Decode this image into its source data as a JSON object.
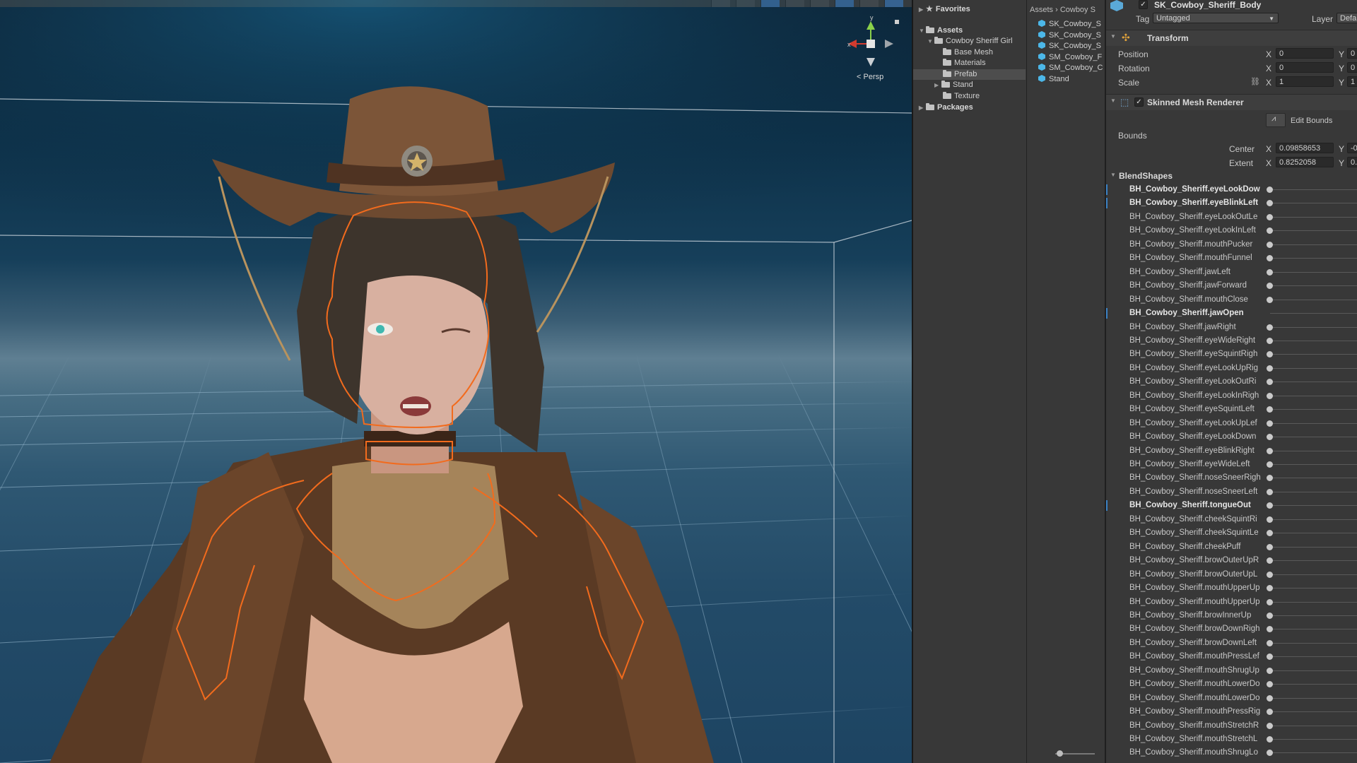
{
  "scene": {
    "projection_label": "Persp",
    "gizmo_axes": {
      "x": "x",
      "y": "y"
    },
    "toolbar_icons": [
      "effects-icon",
      "layers-icon",
      "lighting-icon",
      "audio-icon",
      "fx-icon",
      "search-scene-icon",
      "gizmos-icon",
      "camera-icon"
    ]
  },
  "project": {
    "favorites_label": "Favorites",
    "assets_label": "Assets",
    "tree": [
      {
        "label": "Cowboy Sheriff Girl",
        "level": 1
      },
      {
        "label": "Base Mesh",
        "level": 2
      },
      {
        "label": "Materials",
        "level": 2
      },
      {
        "label": "Prefab",
        "level": 2,
        "selected": true
      },
      {
        "label": "Stand",
        "level": 2,
        "expandable": true
      },
      {
        "label": "Texture",
        "level": 2
      }
    ],
    "packages_label": "Packages",
    "breadcrumb": [
      "Assets",
      "Cowboy S"
    ],
    "files": [
      "SK_Cowboy_S",
      "SK_Cowboy_S",
      "SK_Cowboy_S",
      "SM_Cowboy_F",
      "SM_Cowboy_C",
      "Stand"
    ]
  },
  "inspector": {
    "object_name": "SK_Cowboy_Sheriff_Body",
    "tag_label": "Tag",
    "tag_value": "Untagged",
    "layer_label": "Layer",
    "layer_value": "Defa",
    "transform": {
      "title": "Transform",
      "rows": [
        {
          "label": "Position",
          "x": "0",
          "y": "0"
        },
        {
          "label": "Rotation",
          "x": "0",
          "y": "0"
        },
        {
          "label": "Scale",
          "x": "1",
          "y": "1"
        }
      ]
    },
    "smr": {
      "title": "Skinned Mesh Renderer",
      "edit_bounds": "Edit Bounds",
      "bounds_label": "Bounds",
      "center_label": "Center",
      "center_x": "0.09858653",
      "center_y": "-0",
      "extent_label": "Extent",
      "extent_x": "0.8252058",
      "extent_y": "0."
    },
    "blendshapes_label": "BlendShapes",
    "blendshapes": [
      {
        "name": "BH_Cowboy_Sheriff.eyeLookDow",
        "bold": true,
        "changed": true
      },
      {
        "name": "BH_Cowboy_Sheriff.eyeBlinkLeft",
        "bold": true,
        "changed": true
      },
      {
        "name": "BH_Cowboy_Sheriff.eyeLookOutLe"
      },
      {
        "name": "BH_Cowboy_Sheriff.eyeLookInLeft"
      },
      {
        "name": "BH_Cowboy_Sheriff.mouthPucker"
      },
      {
        "name": "BH_Cowboy_Sheriff.mouthFunnel"
      },
      {
        "name": "BH_Cowboy_Sheriff.jawLeft"
      },
      {
        "name": "BH_Cowboy_Sheriff.jawForward"
      },
      {
        "name": "BH_Cowboy_Sheriff.mouthClose"
      },
      {
        "name": "BH_Cowboy_Sheriff.jawOpen",
        "bold": true,
        "changed": true,
        "no_knob": true
      },
      {
        "name": "BH_Cowboy_Sheriff.jawRight"
      },
      {
        "name": "BH_Cowboy_Sheriff.eyeWideRight"
      },
      {
        "name": "BH_Cowboy_Sheriff.eyeSquintRigh"
      },
      {
        "name": "BH_Cowboy_Sheriff.eyeLookUpRig"
      },
      {
        "name": "BH_Cowboy_Sheriff.eyeLookOutRi"
      },
      {
        "name": "BH_Cowboy_Sheriff.eyeLookInRigh"
      },
      {
        "name": "BH_Cowboy_Sheriff.eyeSquintLeft"
      },
      {
        "name": "BH_Cowboy_Sheriff.eyeLookUpLef"
      },
      {
        "name": "BH_Cowboy_Sheriff.eyeLookDown"
      },
      {
        "name": "BH_Cowboy_Sheriff.eyeBlinkRight"
      },
      {
        "name": "BH_Cowboy_Sheriff.eyeWideLeft"
      },
      {
        "name": "BH_Cowboy_Sheriff.noseSneerRigh"
      },
      {
        "name": "BH_Cowboy_Sheriff.noseSneerLeft"
      },
      {
        "name": "BH_Cowboy_Sheriff.tongueOut",
        "bold": true,
        "changed": true
      },
      {
        "name": "BH_Cowboy_Sheriff.cheekSquintRi"
      },
      {
        "name": "BH_Cowboy_Sheriff.cheekSquintLe"
      },
      {
        "name": "BH_Cowboy_Sheriff.cheekPuff"
      },
      {
        "name": "BH_Cowboy_Sheriff.browOuterUpR"
      },
      {
        "name": "BH_Cowboy_Sheriff.browOuterUpL"
      },
      {
        "name": "BH_Cowboy_Sheriff.mouthUpperUp"
      },
      {
        "name": "BH_Cowboy_Sheriff.mouthUpperUp"
      },
      {
        "name": "BH_Cowboy_Sheriff.browInnerUp"
      },
      {
        "name": "BH_Cowboy_Sheriff.browDownRigh"
      },
      {
        "name": "BH_Cowboy_Sheriff.browDownLeft"
      },
      {
        "name": "BH_Cowboy_Sheriff.mouthPressLef"
      },
      {
        "name": "BH_Cowboy_Sheriff.mouthShrugUp"
      },
      {
        "name": "BH_Cowboy_Sheriff.mouthLowerDo"
      },
      {
        "name": "BH_Cowboy_Sheriff.mouthLowerDo"
      },
      {
        "name": "BH_Cowboy_Sheriff.mouthPressRig"
      },
      {
        "name": "BH_Cowboy_Sheriff.mouthStretchR"
      },
      {
        "name": "BH_Cowboy_Sheriff.mouthStretchL"
      },
      {
        "name": "BH_Cowboy_Sheriff.mouthShrugLo"
      }
    ]
  },
  "colors": {
    "accent_blue": "#3b82c4",
    "selection_orange": "#f26b1d",
    "panel_bg": "#383838"
  }
}
